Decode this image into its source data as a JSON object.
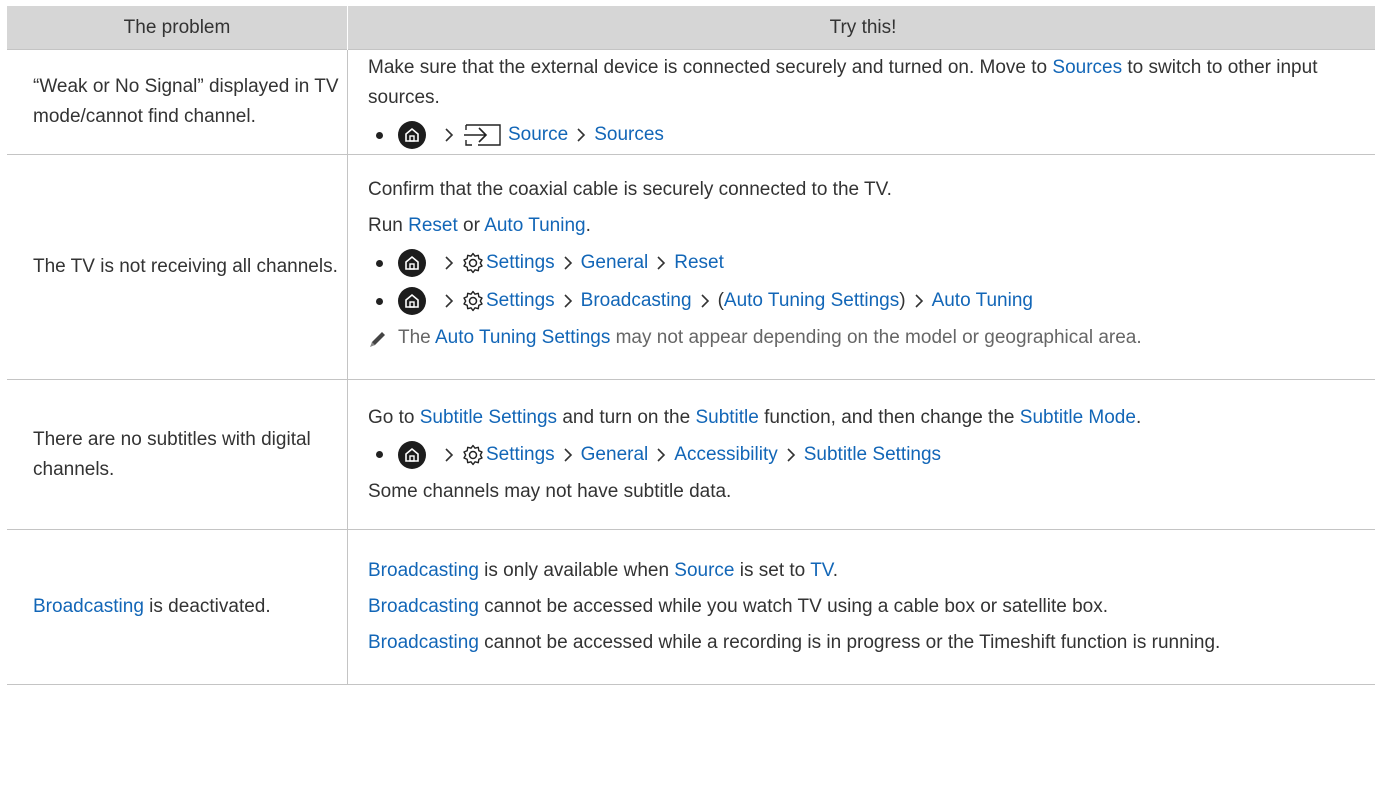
{
  "header": {
    "col1": "The problem",
    "col2": "Try this!"
  },
  "rows": [
    {
      "problem": "“Weak or No Signal” displayed in TV mode/cannot find channel.",
      "p1_a": "Make sure that the external device is connected securely and turned on. Move to ",
      "p1_b": "Sources",
      "p1_c": " to switch to other input sources.",
      "path": [
        "Source",
        "Sources"
      ]
    },
    {
      "problem": "The TV is not receiving all channels.",
      "p1": "Confirm that the coaxial cable is securely connected to the TV.",
      "p2_a": "Run ",
      "p2_b": "Reset",
      "p2_c": " or ",
      "p2_d": "Auto Tuning",
      "p2_e": ".",
      "path1": [
        "Settings",
        "General",
        "Reset"
      ],
      "path2_a": "Settings",
      "path2_b": "Broadcasting",
      "path2_c": "(",
      "path2_d": "Auto Tuning Settings",
      "path2_e": ")",
      "path2_f": "Auto Tuning",
      "note_a": "The ",
      "note_b": "Auto Tuning Settings",
      "note_c": " may not appear depending on the model or geographical area."
    },
    {
      "problem": "There are no subtitles with digital channels.",
      "p1_a": "Go to ",
      "p1_b": "Subtitle Settings",
      "p1_c": " and turn on the ",
      "p1_d": "Subtitle",
      "p1_e": " function, and then change the ",
      "p1_f": "Subtitle Mode",
      "p1_g": ".",
      "path": [
        "Settings",
        "General",
        "Accessibility",
        "Subtitle Settings"
      ],
      "p2": "Some channels may not have subtitle data."
    },
    {
      "problem_a": "Broadcasting",
      "problem_b": " is deactivated.",
      "p1_a": "Broadcasting",
      "p1_b": " is only available when ",
      "p1_c": "Source",
      "p1_d": " is set to ",
      "p1_e": "TV",
      "p1_f": ".",
      "p2_a": "Broadcasting",
      "p2_b": " cannot be accessed while you watch TV using a cable box or satellite box.",
      "p3_a": "Broadcasting",
      "p3_b": " cannot be accessed while a recording is in progress or the Timeshift function is running."
    }
  ],
  "icons": {
    "home": "home-icon",
    "chevron": "chevron-right-icon",
    "settings": "gear-icon",
    "source": "source-input-icon",
    "note": "pencil-note-icon"
  },
  "colors": {
    "link": "#1266b7",
    "header_bg": "#d6d6d6",
    "text": "#333333",
    "note_text": "#666666"
  }
}
